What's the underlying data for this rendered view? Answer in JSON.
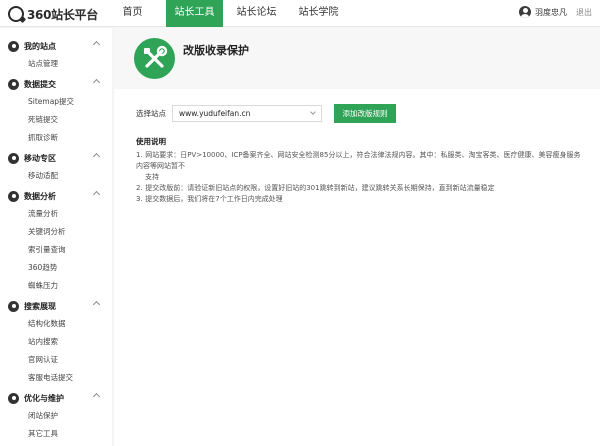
{
  "header": {
    "logo_text": "360站长平台",
    "nav": [
      "首页",
      "站长工具",
      "站长论坛",
      "站长学院"
    ],
    "active_nav_index": 1,
    "user_name": "羽度忠凡",
    "logout_label": "退出"
  },
  "sidebar": {
    "groups": [
      {
        "title": "我的站点",
        "icon": "home-icon",
        "items": [
          "站点管理"
        ]
      },
      {
        "title": "数据提交",
        "icon": "upload-icon",
        "items": [
          "Sitemap提交",
          "死链提交",
          "抓取诊断"
        ]
      },
      {
        "title": "移动专区",
        "icon": "mobile-icon",
        "items": [
          "移动适配"
        ]
      },
      {
        "title": "数据分析",
        "icon": "analytics-icon",
        "items": [
          "流量分析",
          "关键词分析",
          "索引量查询",
          "360趋势",
          "蜘蛛压力"
        ]
      },
      {
        "title": "搜索展现",
        "icon": "search-display-icon",
        "items": [
          "结构化数据",
          "站内搜索",
          "官网认证",
          "客服电话提交"
        ]
      },
      {
        "title": "优化与维护",
        "icon": "tools-icon",
        "items": [
          "闭站保护",
          "其它工具"
        ]
      }
    ]
  },
  "main": {
    "title": "改版收录保护",
    "hero_color": "#2fa356",
    "site_label": "选择站点",
    "site_value": "www.yudufeifan.cn",
    "add_rule_label": "添加改版规则",
    "usage": {
      "title": "使用说明",
      "items": [
        {
          "num": "1.",
          "line1": "网站要求：日PV>10000、ICP备案齐全、网站安全检测85分以上，符合法律法规内容。其中：私服类、淘宝客类、医疗健康、美容瘦身服务内容等网站暂不",
          "line2": "支持"
        },
        {
          "num": "2.",
          "line1": "提交改版前：请验证新旧站点的权限，设置好旧站的301跳转到新站，建议跳转关系长期保持，直到新站流量稳定"
        },
        {
          "num": "3.",
          "line1": "提交数据后，我们将在7个工作日内完成处理"
        }
      ]
    }
  }
}
